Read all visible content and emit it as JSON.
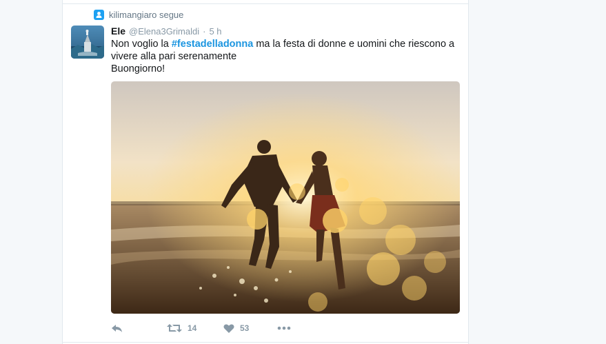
{
  "context": {
    "text": "kilimangiaro segue",
    "icon": "person-follow-icon"
  },
  "tweet": {
    "fullname": "Ele",
    "username": "@Elena3Grimaldi",
    "separator": "·",
    "time": "5 h",
    "text_before": "Non voglio la ",
    "hashtag": "#festadelladonna",
    "text_after": " ma la festa di donne e uomini che riescono a vivere alla pari serenamente",
    "text_line2": "Buongiorno!",
    "hashtag_color": "#1b95e0"
  },
  "actions": {
    "reply_icon": "reply-icon",
    "retweet_icon": "retweet-icon",
    "retweet_count": "14",
    "like_icon": "heart-icon",
    "like_count": "53",
    "more_icon": "more-dots-icon"
  },
  "colors": {
    "accent": "#1da1f2",
    "muted": "#8899a6",
    "text": "#14171a",
    "border": "#e1e8ed"
  }
}
